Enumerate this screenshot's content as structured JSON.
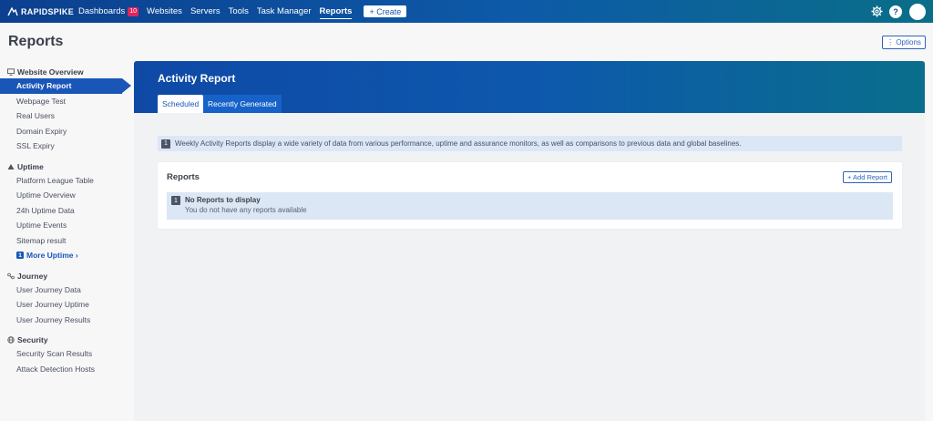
{
  "nav": {
    "logo_text": "RAPIDSPIKE",
    "items": [
      {
        "label": "Dashboards",
        "badge": "10"
      },
      {
        "label": "Websites"
      },
      {
        "label": "Servers"
      },
      {
        "label": "Tools"
      },
      {
        "label": "Task Manager"
      },
      {
        "label": "Reports",
        "active": true
      }
    ],
    "create_label": "+ Create",
    "help_label": "?"
  },
  "page": {
    "title": "Reports",
    "options_label": "⋮ Options"
  },
  "sidebar": {
    "sections": [
      {
        "title": "Website Overview",
        "icon": "monitor-icon",
        "items": [
          "Activity Report",
          "Webpage Test",
          "Real Users",
          "Domain Expiry",
          "SSL Expiry"
        ]
      },
      {
        "title": "Uptime",
        "icon": "triangle-up-icon",
        "items": [
          "Platform League Table",
          "Uptime Overview",
          "24h Uptime Data",
          "Uptime Events",
          "Sitemap result"
        ],
        "more_badge": "1",
        "more_label": "More Uptime ›"
      },
      {
        "title": "Journey",
        "icon": "journey-icon",
        "items": [
          "User Journey Data",
          "User Journey Uptime",
          "User Journey Results"
        ]
      },
      {
        "title": "Security",
        "icon": "globe-icon",
        "items": [
          "Security Scan Results",
          "Attack Detection Hosts"
        ]
      }
    ],
    "active_item": "Activity Report"
  },
  "main": {
    "title": "Activity Report",
    "tabs": [
      "Scheduled",
      "Recently Generated"
    ],
    "info_badge": "1",
    "info_text": "Weekly Activity Reports display a wide variety of data from various performance, uptime and assurance monitors, as well as comparisons to previous data and global baselines.",
    "card": {
      "title": "Reports",
      "add_label": "+ Add Report",
      "empty_badge": "1",
      "empty_title": "No Reports to display",
      "empty_sub": "You do not have any reports available"
    }
  },
  "colors": {
    "primary": "#1a56b8",
    "nav_start": "#0c3f8f",
    "nav_end": "#0a6e88",
    "info_bg": "#dce7f5",
    "badge_red": "#e0245e"
  }
}
